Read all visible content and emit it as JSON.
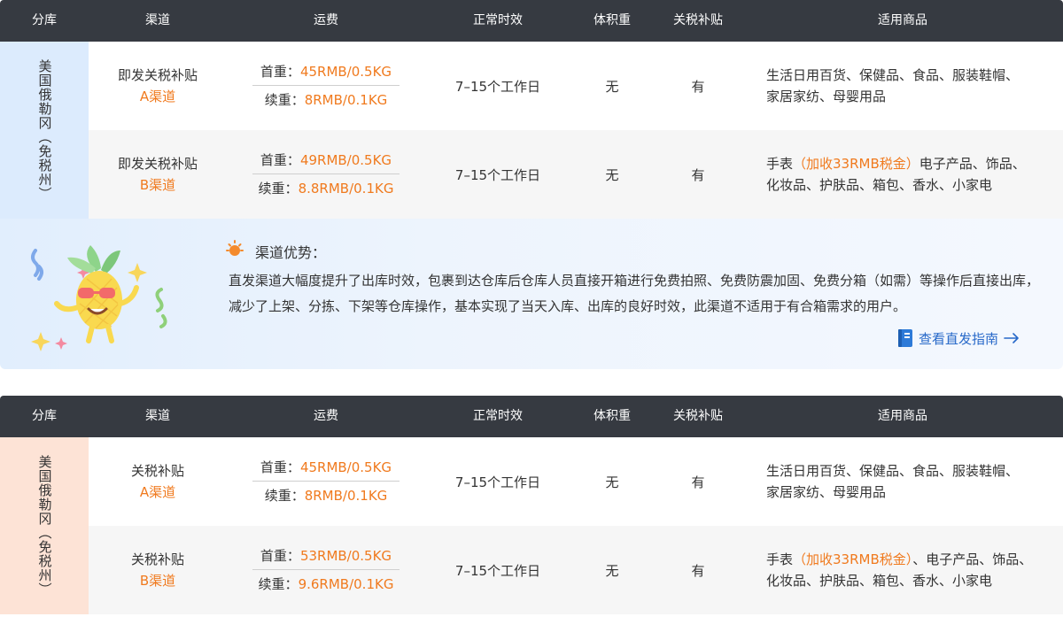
{
  "headers": {
    "warehouse": "分库",
    "channel": "渠道",
    "fee": "运费",
    "time": "正常时效",
    "volume": "体积重",
    "tax": "关税补贴",
    "goods": "适用商品"
  },
  "table1": {
    "warehouse": "美国俄勒冈（免税州）",
    "rows": [
      {
        "channel_name": "即发关税补贴",
        "channel_code": "A渠道",
        "first_label": "首重：",
        "first_value": "45RMB/0.5KG",
        "cont_label": "续重：",
        "cont_value": "8RMB/0.1KG",
        "time": "7–15个工作日",
        "volume": "无",
        "tax": "有",
        "goods_line1": "生活日用百货、保健品、食品、服装鞋帽、",
        "goods_line2": "家居家纺、母婴用品"
      },
      {
        "channel_name": "即发关税补贴",
        "channel_code": "B渠道",
        "first_label": "首重：",
        "first_value": "49RMB/0.5KG",
        "cont_label": "续重：",
        "cont_value": "8.8RMB/0.1KG",
        "time": "7–15个工作日",
        "volume": "无",
        "tax": "有",
        "goods_prefix": "手表",
        "goods_highlight": "（加收33RMB税金）",
        "goods_rest": "电子产品、饰品、",
        "goods_line2": "化妆品、护肤品、箱包、香水、小家电"
      }
    ]
  },
  "advantage": {
    "title": "渠道优势：",
    "text": "直发渠道大幅度提升了出库时效，包裹到达仓库后仓库人员直接开箱进行免费拍照、免费防震加固、免费分箱（如需）等操作后直接出库，减少了上架、分拣、下架等仓库操作，基本实现了当天入库、出库的良好时效，此渠道不适用于有合箱需求的用户。",
    "link": "查看直发指南"
  },
  "table2": {
    "warehouse": "美国俄勒冈（免税州）",
    "rows": [
      {
        "channel_name": "关税补贴",
        "channel_code": "A渠道",
        "first_label": "首重：",
        "first_value": "45RMB/0.5KG",
        "cont_label": "续重：",
        "cont_value": "8RMB/0.1KG",
        "time": "7–15个工作日",
        "volume": "无",
        "tax": "有",
        "goods_line1": "生活日用百货、保健品、食品、服装鞋帽、",
        "goods_line2": "家居家纺、母婴用品"
      },
      {
        "channel_name": "关税补贴",
        "channel_code": "B渠道",
        "first_label": "首重：",
        "first_value": "53RMB/0.5KG",
        "cont_label": "续重：",
        "cont_value": "9.6RMB/0.1KG",
        "time": "7–15个工作日",
        "volume": "无",
        "tax": "有",
        "goods_prefix": "手表",
        "goods_highlight": "（加收33RMB税金）",
        "goods_rest": "、电子产品、饰品、",
        "goods_line2": "化妆品、护肤品、箱包、香水、小家电"
      }
    ]
  },
  "colors": {
    "header_bg": "#363a41",
    "accent_orange": "#f07a1e",
    "link_blue": "#2769c9",
    "warehouse_blue": "#dcebfd",
    "warehouse_peach": "#fde3d6"
  },
  "icons": {
    "sun": "lightbulb-sun-icon",
    "guide": "guide-book-icon",
    "arrow": "arrow-right-icon",
    "mascot": "pineapple-mascot"
  }
}
